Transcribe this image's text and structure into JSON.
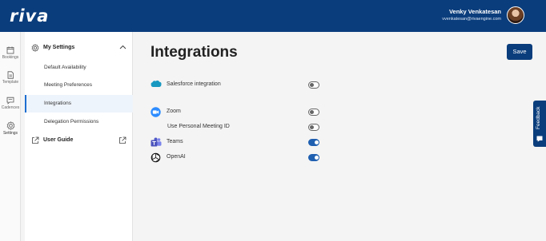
{
  "header": {
    "logo": "riva",
    "user_name": "Venky Venkatesan",
    "user_email": "vvenkatesan@rivaengine.com"
  },
  "rail": {
    "items": [
      {
        "label": "Bookings",
        "icon": "calendar-icon"
      },
      {
        "label": "Template",
        "icon": "document-icon"
      },
      {
        "label": "Cadences",
        "icon": "message-icon"
      },
      {
        "label": "Settings",
        "icon": "gear-icon"
      }
    ]
  },
  "settings_panel": {
    "title": "My Settings",
    "items": [
      {
        "label": "Default Availability"
      },
      {
        "label": "Meeting Preferences"
      },
      {
        "label": "Integrations",
        "active": true
      },
      {
        "label": "Delegation Permissions"
      }
    ],
    "user_guide": "User Guide"
  },
  "main": {
    "title": "Integrations",
    "save_label": "Save",
    "integrations": [
      {
        "label": "Salesforce integration",
        "icon": "salesforce-icon",
        "enabled": false
      },
      {
        "label": "Zoom",
        "icon": "zoom-icon",
        "enabled": false
      },
      {
        "label": "Use Personal Meeting ID",
        "enabled": false
      },
      {
        "label": "Teams",
        "icon": "teams-icon",
        "enabled": true
      },
      {
        "label": "OpenAI",
        "icon": "openai-icon",
        "enabled": true
      }
    ]
  },
  "feedback": {
    "label": "Feedback"
  },
  "colors": {
    "header": "#0a3d7c",
    "accent": "#1f5fb0",
    "active_bg": "#eef4fb"
  }
}
